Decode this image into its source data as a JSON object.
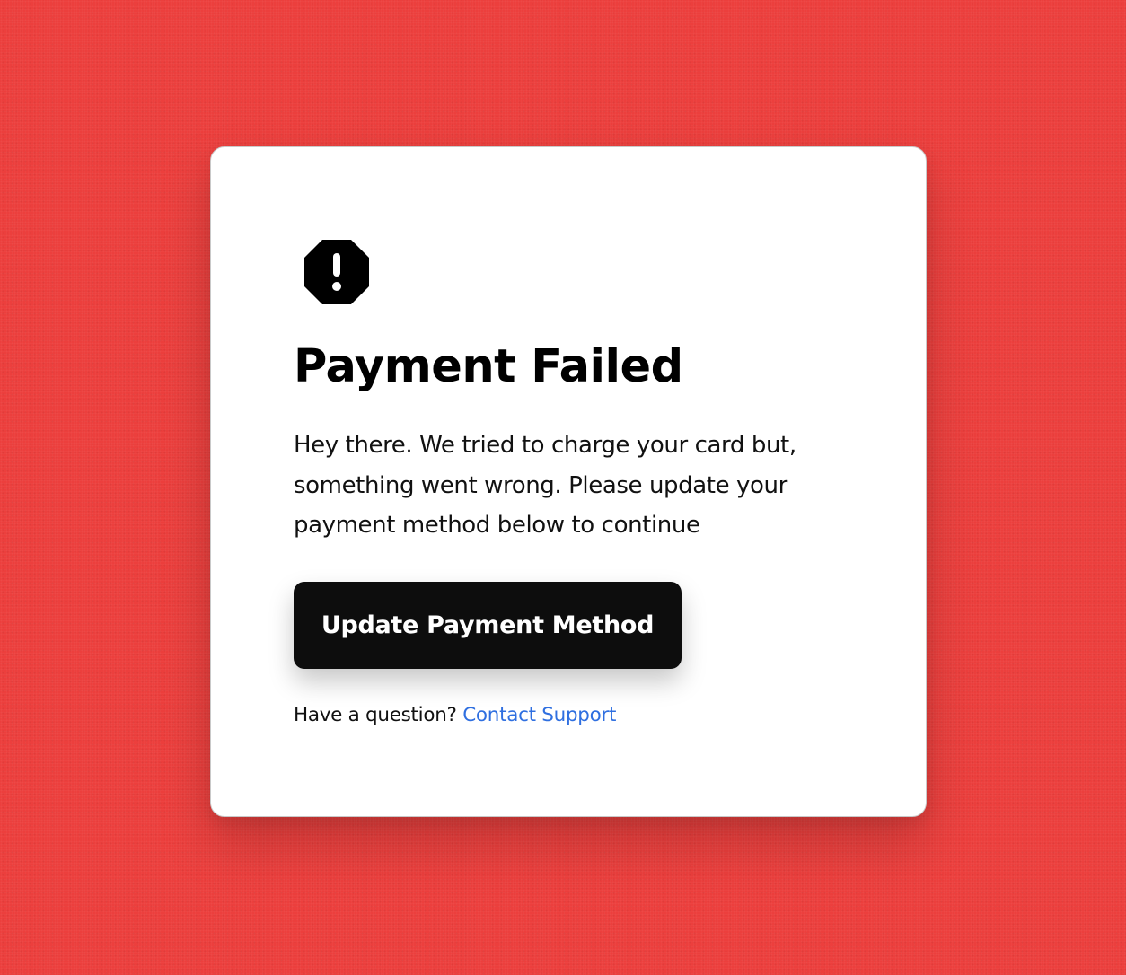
{
  "colors": {
    "background": "#ec3f3d",
    "card": "#ffffff",
    "button": "#0d0d0d",
    "button_text": "#ffffff",
    "link": "#2f6fe0"
  },
  "dialog": {
    "icon": "octagon-alert-icon",
    "title": "Payment Failed",
    "message": "Hey there. We tried to charge your card but, something went wrong. Please update your payment method below to continue",
    "primary_button_label": "Update Payment Method",
    "help_text": "Have a question?",
    "help_link_label": "Contact Support"
  }
}
